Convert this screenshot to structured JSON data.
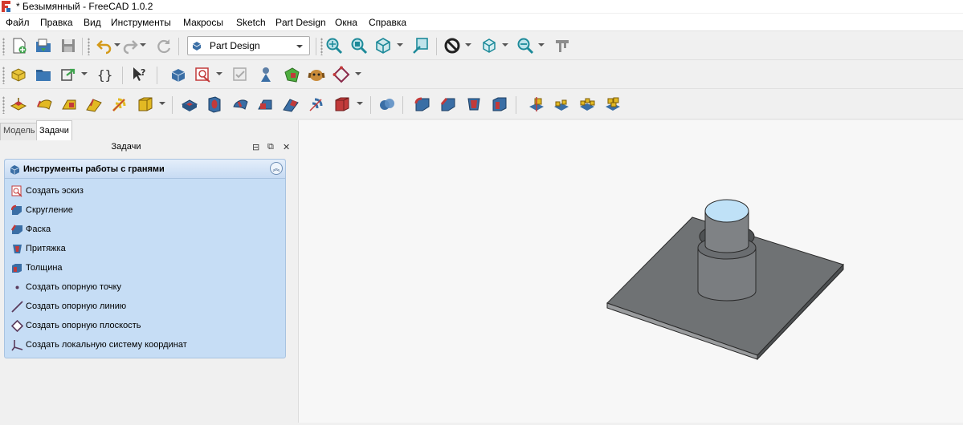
{
  "window": {
    "title": "* Безымянный - FreeCAD 1.0.2"
  },
  "menu": [
    "Файл",
    "Правка",
    "Вид",
    "Инструменты",
    "Макросы",
    "Sketch",
    "Part Design",
    "Окна",
    "Справка"
  ],
  "workbench": {
    "selected": "Part Design"
  },
  "toolbar1": {
    "icons": [
      "new-document-icon",
      "open-document-icon",
      "save-document-icon",
      "undo-icon",
      "redo-icon",
      "refresh-icon",
      "fit-all-icon",
      "fit-selection-icon",
      "isometric-view-icon",
      "box-zoom-icon",
      "draw-style-icon",
      "stereo-view-icon",
      "zoom-icon",
      "measure-icon"
    ]
  },
  "toolbar2": {
    "icons": [
      "create-part-icon",
      "create-group-icon",
      "link-actions-icon",
      "variable-set-icon",
      "whats-this-icon",
      "create-body-icon",
      "create-sketch-icon",
      "validate-sketch-icon",
      "shape-binder-icon",
      "subshape-binder-icon",
      "clone-icon",
      "datum-plane-icon"
    ]
  },
  "toolbar3": {
    "icons": [
      "pad-icon",
      "revolution-icon",
      "additive-loft-icon",
      "additive-pipe-icon",
      "additive-helix-icon",
      "additive-box-icon",
      "pocket-icon",
      "hole-icon",
      "groove-icon",
      "subtractive-loft-icon",
      "subtractive-pipe-icon",
      "subtractive-helix-icon",
      "subtractive-box-icon",
      "boolean-icon",
      "fillet-icon",
      "chamfer-icon",
      "draft-icon",
      "thickness-icon",
      "mirrored-icon",
      "linear-pattern-icon",
      "polar-pattern-icon",
      "multi-transform-icon"
    ]
  },
  "combo_tabs": [
    "Модель",
    "Задачи"
  ],
  "panel": {
    "title": "Задачи",
    "taskbox": {
      "title": "Инструменты работы с гранями",
      "items": [
        {
          "label": "Создать эскиз",
          "icon": "sketch-icon"
        },
        {
          "label": "Скругление",
          "icon": "fillet-icon"
        },
        {
          "label": "Фаска",
          "icon": "chamfer-icon"
        },
        {
          "label": "Притяжка",
          "icon": "draft-icon"
        },
        {
          "label": "Толщина",
          "icon": "thickness-icon"
        },
        {
          "label": "Создать опорную точку",
          "icon": "datum-point-icon"
        },
        {
          "label": "Создать опорную линию",
          "icon": "datum-line-icon"
        },
        {
          "label": "Создать опорную плоскость",
          "icon": "datum-plane-icon"
        },
        {
          "label": "Создать локальную систему координат",
          "icon": "local-coordinate-system-icon"
        }
      ]
    }
  },
  "viewport": {
    "model": "plate-with-stepped-cylinder"
  }
}
